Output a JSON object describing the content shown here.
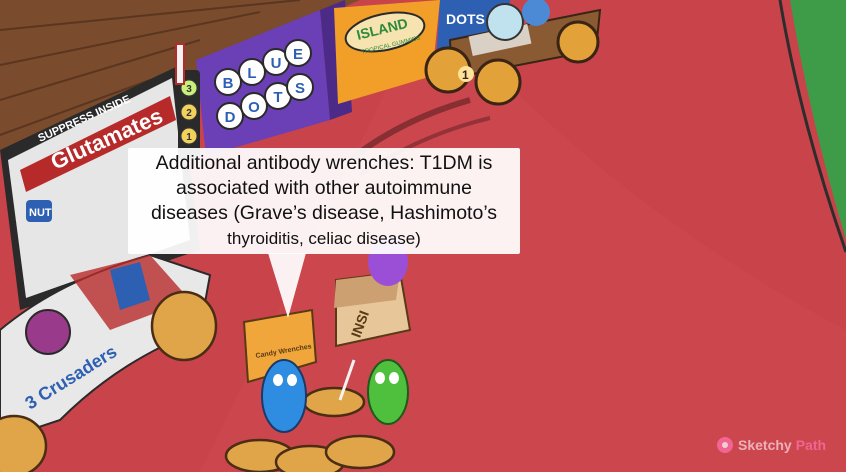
{
  "callout": {
    "line1": "Additional antibody wrenches: T1DM is",
    "line2": "associated with other autoimmune",
    "line3": "diseases (Grave’s disease, Hashimoto’s",
    "line4": "thyroiditis, celiac disease)"
  },
  "boxes": {
    "suppress": "SUPPRESS INSIDE",
    "glutamates": "Glutamates",
    "nut": "NUT",
    "blue": [
      "B",
      "L",
      "U",
      "E"
    ],
    "dots": [
      "D",
      "O",
      "T",
      "S"
    ],
    "island": "ISLAND",
    "island_sub": "TROPICAL GUMMIES",
    "dots_top": "DOTS"
  },
  "car": {
    "name": "3 Crusaders",
    "number": "1"
  },
  "props": {
    "candy_box": "Candy Wrenches",
    "insi": "INSI",
    "gauge": [
      "3",
      "2",
      "1"
    ]
  },
  "watermark": {
    "brand_a": "Sketchy",
    "brand_b": "Path"
  },
  "colors": {
    "track": "#c8434a",
    "grass": "#3e9b47",
    "fence": "#7a4b2c",
    "callout_bg": "#ffffff"
  }
}
